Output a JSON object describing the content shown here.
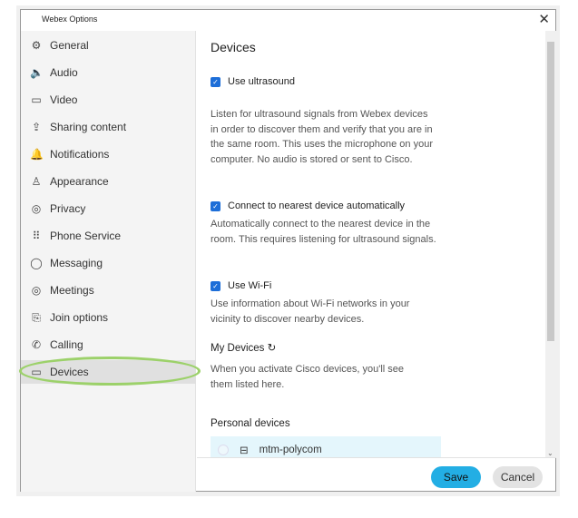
{
  "window": {
    "title": "Webex Options",
    "close": "✕"
  },
  "sidebar": {
    "items": [
      {
        "label": "General",
        "icon": "⚙"
      },
      {
        "label": "Audio",
        "icon": "🔈"
      },
      {
        "label": "Video",
        "icon": "▭"
      },
      {
        "label": "Sharing content",
        "icon": "⇪"
      },
      {
        "label": "Notifications",
        "icon": "🔔"
      },
      {
        "label": "Appearance",
        "icon": "♙"
      },
      {
        "label": "Privacy",
        "icon": "◎"
      },
      {
        "label": "Phone Service",
        "icon": "⠿"
      },
      {
        "label": "Messaging",
        "icon": "◯"
      },
      {
        "label": "Meetings",
        "icon": "◎"
      },
      {
        "label": "Join options",
        "icon": "⎘"
      },
      {
        "label": "Calling",
        "icon": "✆"
      },
      {
        "label": "Devices",
        "icon": "▭"
      }
    ],
    "selected": "Devices"
  },
  "main": {
    "title": "Devices",
    "ultrasound": {
      "label": "Use ultrasound",
      "checked": true,
      "desc": "Listen for ultrasound signals from Webex devices in order to discover them and verify that you are in the same room. This uses the microphone on your computer. No audio is stored or sent to Cisco."
    },
    "auto_connect": {
      "label": "Connect to nearest device automatically",
      "checked": true,
      "desc": "Automatically connect to the nearest device in the room. This requires listening for ultrasound signals."
    },
    "wifi": {
      "label": "Use Wi-Fi",
      "checked": true,
      "desc": "Use information about Wi-Fi networks in your vicinity to discover nearby devices."
    },
    "my_devices": {
      "title": "My Devices",
      "refresh_icon": "↻",
      "desc": "When you activate Cisco devices, you'll see them listed here."
    },
    "personal_devices": {
      "title": "Personal devices",
      "items": [
        {
          "name": "mtm-polycom",
          "icon": "⊟"
        }
      ]
    }
  },
  "footer": {
    "save": "Save",
    "cancel": "Cancel"
  }
}
